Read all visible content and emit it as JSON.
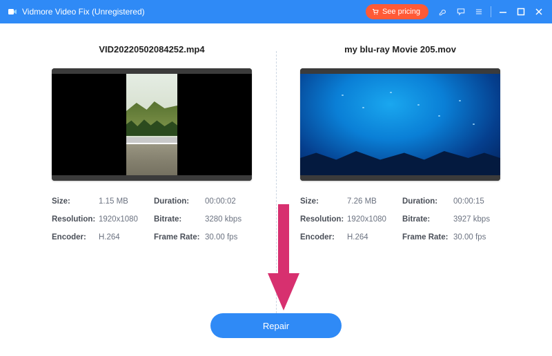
{
  "titlebar": {
    "app_name": "Vidmore Video Fix (Unregistered)",
    "pricing_label": "See pricing"
  },
  "left": {
    "filename": "VID20220502084252.mp4",
    "meta": {
      "size_label": "Size:",
      "size_value": "1.15 MB",
      "duration_label": "Duration:",
      "duration_value": "00:00:02",
      "resolution_label": "Resolution:",
      "resolution_value": "1920x1080",
      "bitrate_label": "Bitrate:",
      "bitrate_value": "3280 kbps",
      "encoder_label": "Encoder:",
      "encoder_value": "H.264",
      "framerate_label": "Frame Rate:",
      "framerate_value": "30.00 fps"
    }
  },
  "right": {
    "filename": "my blu-ray Movie 205.mov",
    "meta": {
      "size_label": "Size:",
      "size_value": "7.26 MB",
      "duration_label": "Duration:",
      "duration_value": "00:00:15",
      "resolution_label": "Resolution:",
      "resolution_value": "1920x1080",
      "bitrate_label": "Bitrate:",
      "bitrate_value": "3927 kbps",
      "encoder_label": "Encoder:",
      "encoder_value": "H.264",
      "framerate_label": "Frame Rate:",
      "framerate_value": "30.00 fps"
    }
  },
  "footer": {
    "repair_label": "Repair"
  },
  "annotation": {
    "arrow_color": "#d7306f"
  }
}
